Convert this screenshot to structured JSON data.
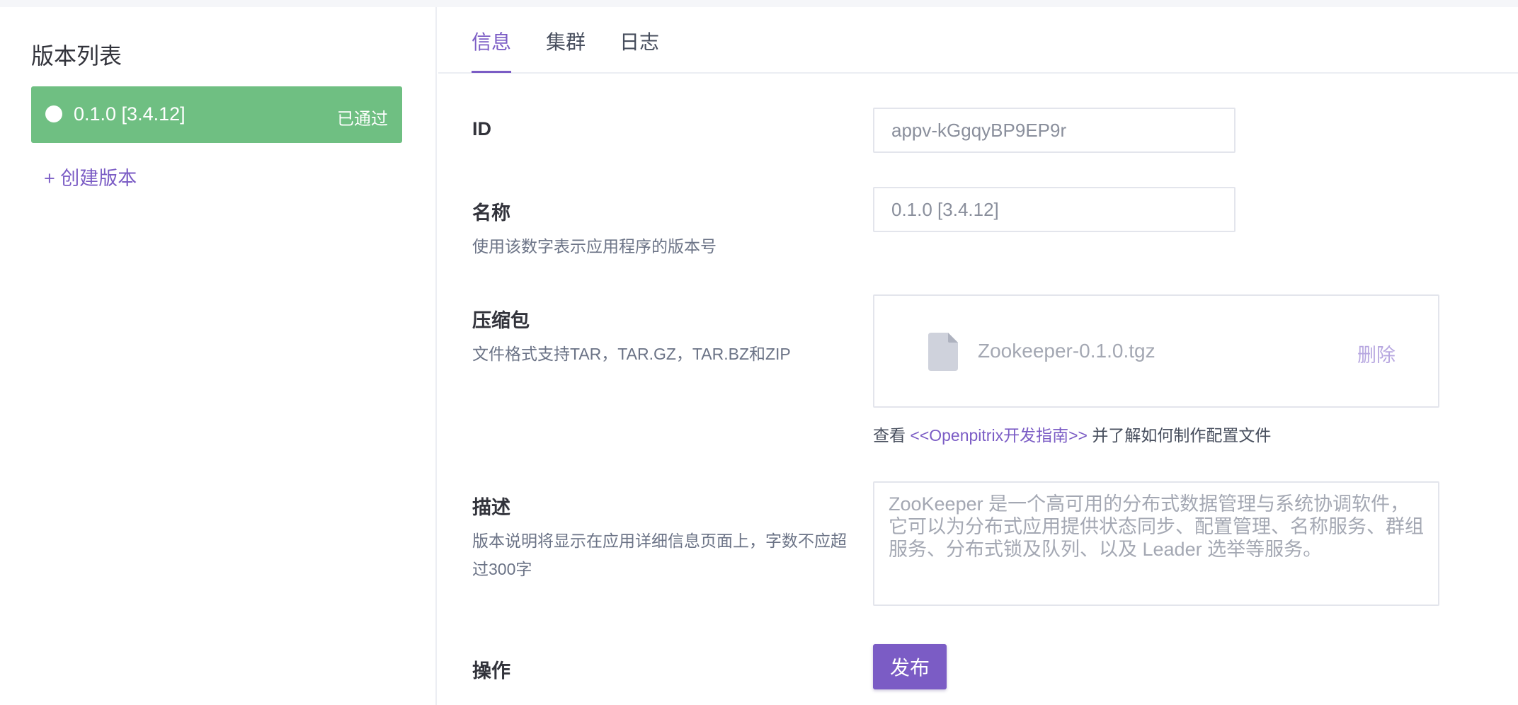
{
  "sidebar": {
    "title": "版本列表",
    "versions": [
      {
        "name": "0.1.0 [3.4.12]",
        "status": "已通过"
      }
    ],
    "create_label": "+ 创建版本"
  },
  "tabs": [
    {
      "label": "信息",
      "active": true
    },
    {
      "label": "集群",
      "active": false
    },
    {
      "label": "日志",
      "active": false
    }
  ],
  "form": {
    "id": {
      "label": "ID",
      "value": "appv-kGgqyBP9EP9r"
    },
    "name": {
      "label": "名称",
      "help": "使用该数字表示应用程序的版本号",
      "value": "0.1.0 [3.4.12]"
    },
    "package": {
      "label": "压缩包",
      "help": "文件格式支持TAR，TAR.GZ，TAR.BZ和ZIP",
      "file_name": "Zookeeper-0.1.0.tgz",
      "delete_label": "删除",
      "guide_prefix": "查看",
      "guide_link": "<<Openpitrix开发指南>>",
      "guide_suffix": "并了解如何制作配置文件"
    },
    "description": {
      "label": "描述",
      "help": "版本说明将显示在应用详细信息页面上，字数不应超过300字",
      "value": "ZooKeeper 是一个高可用的分布式数据管理与系统协调软件，它可以为分布式应用提供状态同步、配置管理、名称服务、群组服务、分布式锁及队列、以及 Leader 选举等服务。"
    },
    "actions": {
      "label": "操作",
      "publish_label": "发布"
    }
  },
  "colors": {
    "accent": "#7b5cc5",
    "success": "#6fbf82",
    "border": "#e3e5ec"
  },
  "icons": {
    "status": "circle-icon",
    "file": "file-icon"
  }
}
